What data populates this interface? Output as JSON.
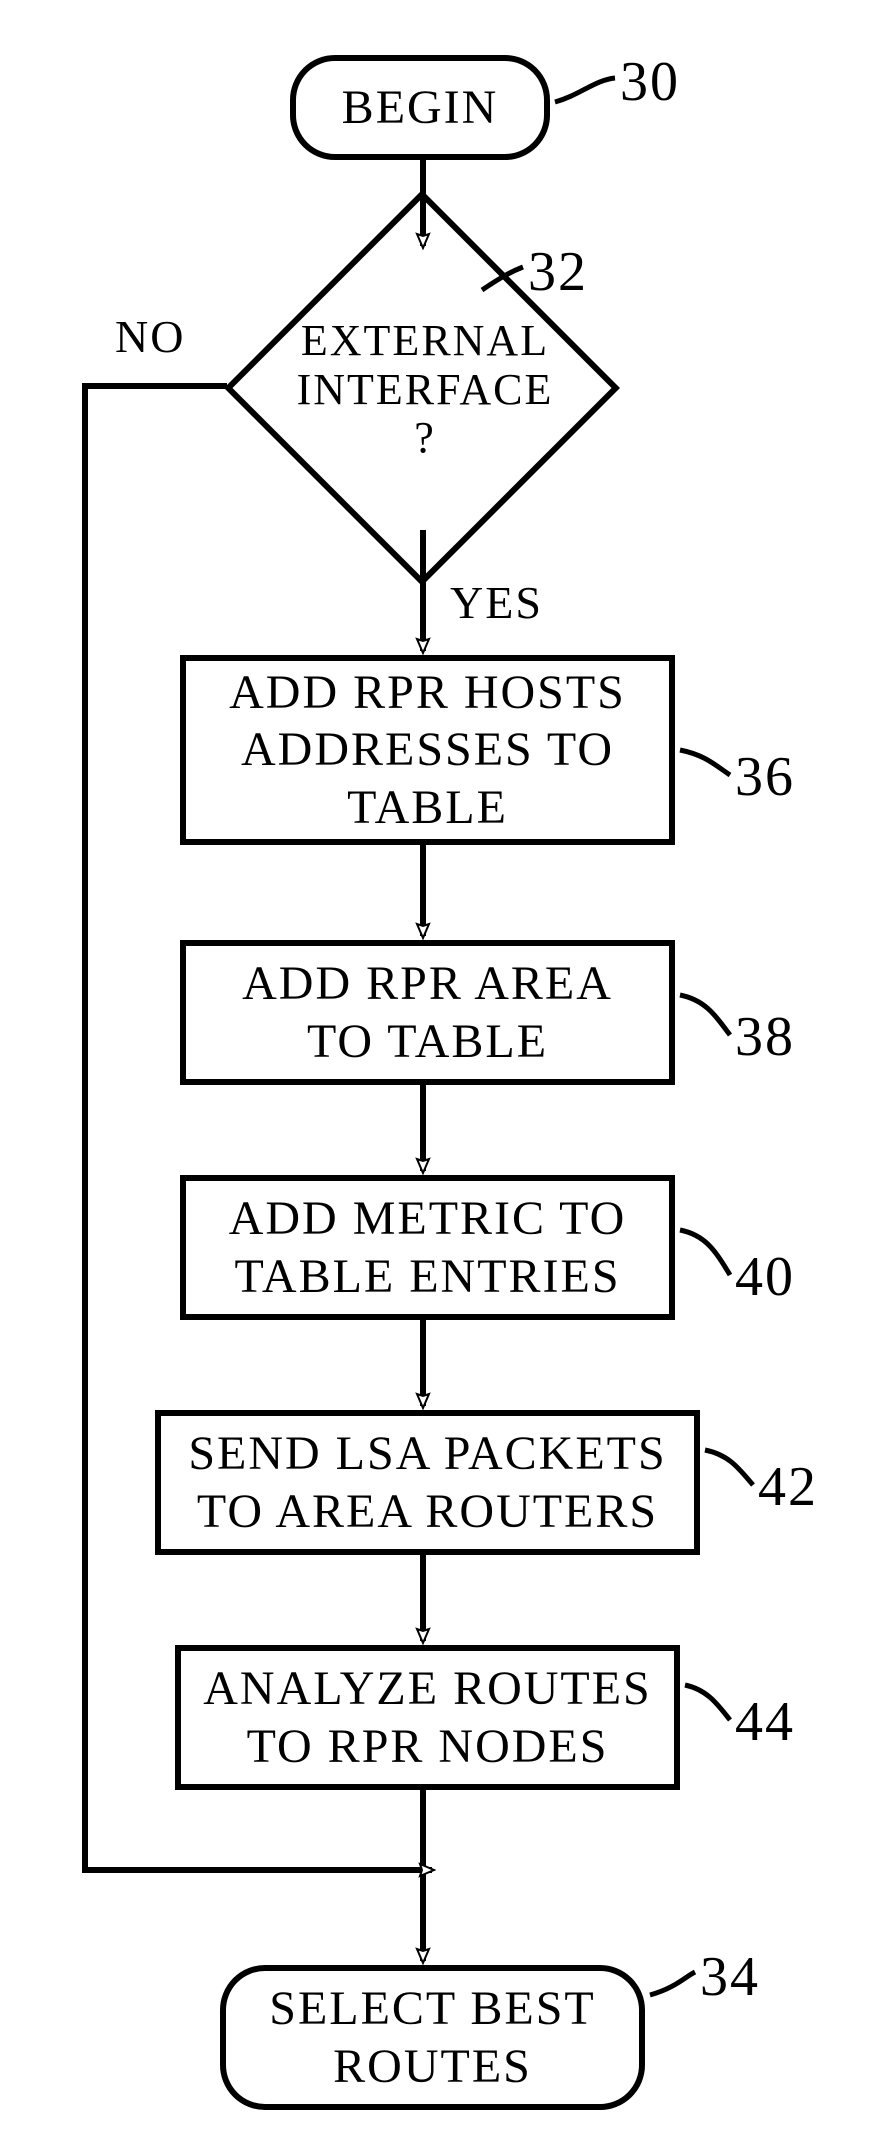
{
  "flowchart": {
    "begin": "BEGIN",
    "decision": "EXTERNAL\nINTERFACE\n?",
    "decision_line1": "EXTERNAL",
    "decision_line2": "INTERFACE",
    "decision_line3": "?",
    "no_label": "NO",
    "yes_label": "YES",
    "step36": "ADD RPR HOSTS\nADDRESSES TO\nTABLE",
    "step36_line1": "ADD RPR HOSTS",
    "step36_line2": "ADDRESSES TO",
    "step36_line3": "TABLE",
    "step38_line1": "ADD RPR AREA",
    "step38_line2": "TO TABLE",
    "step40_line1": "ADD METRIC TO",
    "step40_line2": "TABLE ENTRIES",
    "step42_line1": "SEND LSA PACKETS",
    "step42_line2": "TO AREA ROUTERS",
    "step44_line1": "ANALYZE ROUTES",
    "step44_line2": "TO RPR NODES",
    "end_line1": "SELECT BEST",
    "end_line2": "ROUTES",
    "ref30": "30",
    "ref32": "32",
    "ref36": "36",
    "ref38": "38",
    "ref40": "40",
    "ref42": "42",
    "ref44": "44",
    "ref34": "34"
  }
}
